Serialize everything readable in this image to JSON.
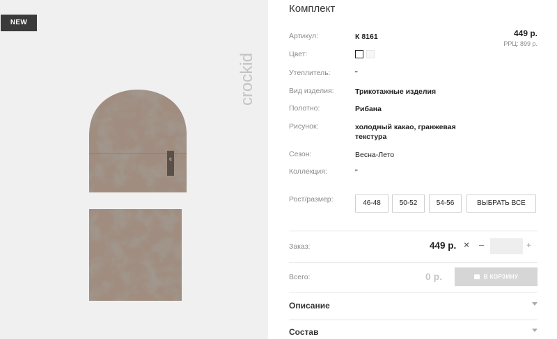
{
  "badge": "NEW",
  "brand": {
    "name": "crockid"
  },
  "product": {
    "title": "Комплект",
    "price": "449 р.",
    "rrp": "РРЦ: 899 р.",
    "tag_letter": "c"
  },
  "attributes": [
    {
      "label": "Артикул:",
      "value": "К 8161"
    },
    {
      "label": "Цвет:",
      "value": ""
    },
    {
      "label": "Утеплитель:",
      "value": "\""
    },
    {
      "label": "Вид изделия:",
      "value": "Трикотажные изделия"
    },
    {
      "label": "Полотно:",
      "value": "Рибана"
    },
    {
      "label": "Рисунок:",
      "value": "холодный какао, гранжевая\nтекстура"
    },
    {
      "label": "Сезон:",
      "value": "Весна-Лето"
    },
    {
      "label": "Коллекция:",
      "value": "\""
    },
    {
      "label": "Рост/размер:",
      "value": ""
    }
  ],
  "sizes": [
    "46-48",
    "50-52",
    "54-56"
  ],
  "select_all": "ВЫБРАТЬ ВСЕ",
  "order": {
    "label": "Заказ:",
    "price": "449 р.",
    "times": "×",
    "minus": "–",
    "plus": "+",
    "qty_value": ""
  },
  "total": {
    "label": "Всего:",
    "value": "0 р.",
    "cart_button": "В КОРЗИНУ"
  },
  "accordion": [
    {
      "label": "Описание"
    },
    {
      "label": "Состав"
    }
  ],
  "colors": {
    "product_base": "#a08d80",
    "product_dark": "#6a5c52",
    "button_disabled": "#d6d6d6",
    "badge_bg": "#3a3a3a"
  }
}
